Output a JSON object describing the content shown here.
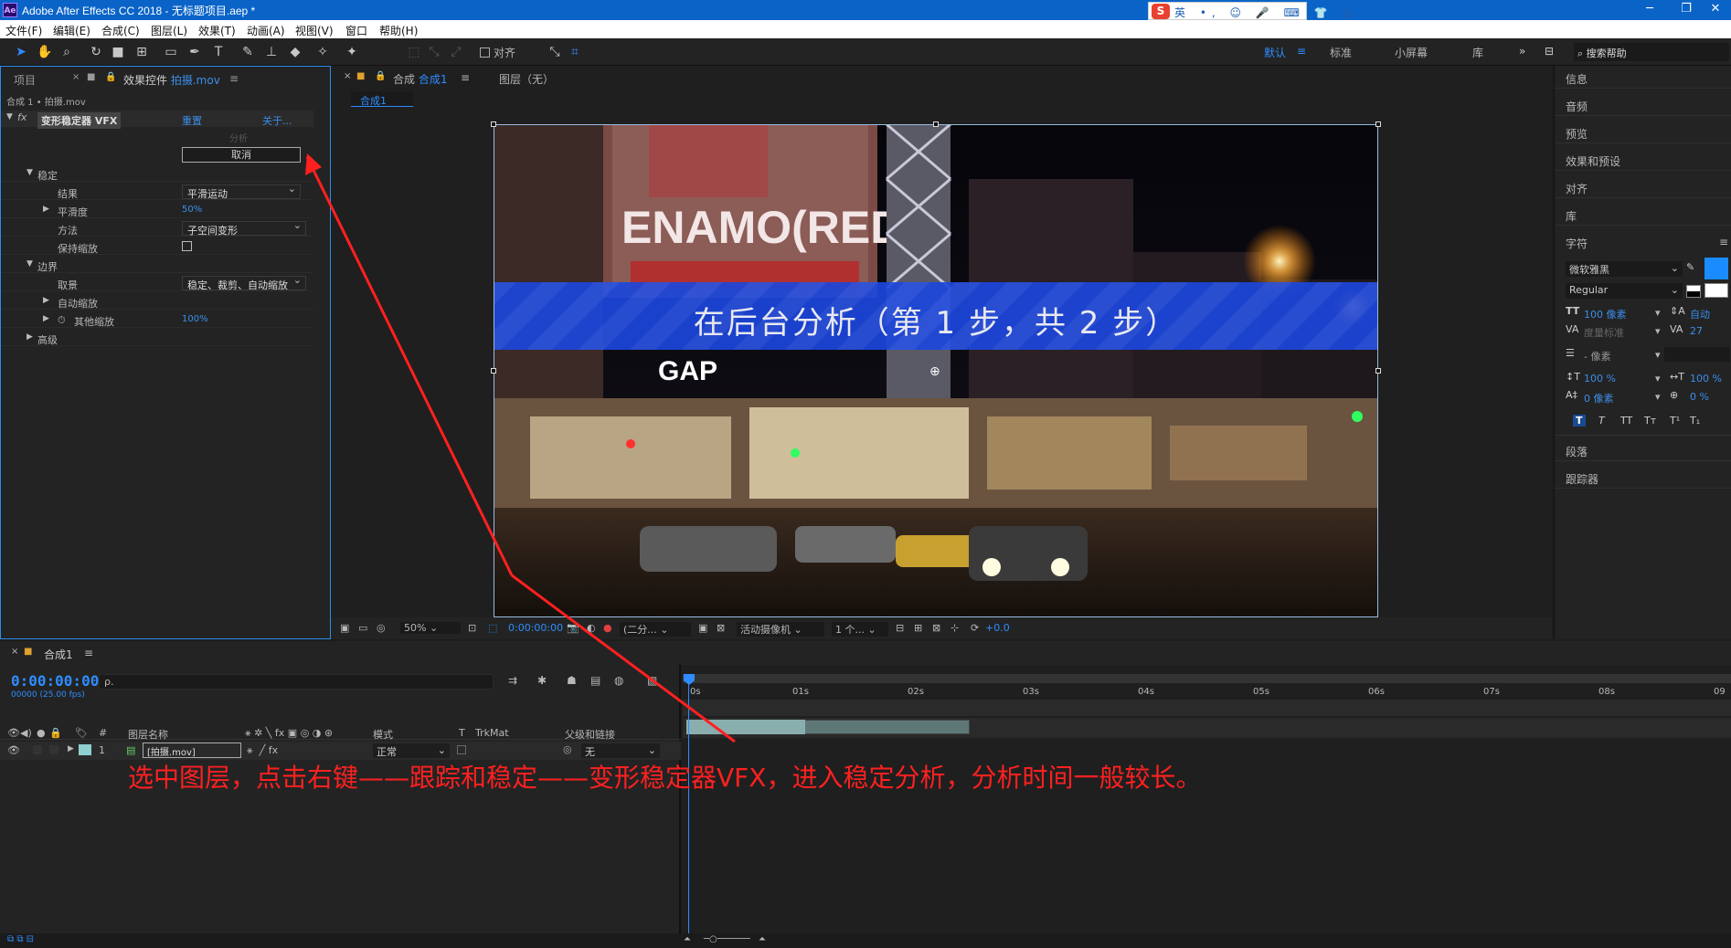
{
  "titlebar": {
    "title": "Adobe After Effects CC 2018 - 无标题项目.aep *",
    "app_icon_text": "Ae",
    "ime_logo": "S",
    "ime_items": "英 •, ☺ 🎤 ⌨ 👕 ▦",
    "minimize": "─",
    "maximize": "❐",
    "close": "✕"
  },
  "menu": [
    "文件(F)",
    "编辑(E)",
    "合成(C)",
    "图层(L)",
    "效果(T)",
    "动画(A)",
    "视图(V)",
    "窗口",
    "帮助(H)"
  ],
  "toolbar": {
    "snap_label": "对齐",
    "workspaces": [
      "默认",
      "标准",
      "小屏幕",
      "库"
    ],
    "more": "»",
    "search_placeholder": "搜索帮助"
  },
  "effect_panel": {
    "tab_project": "项目",
    "tab_effects": "效果控件",
    "tab_effects_file": "拍摄.mov",
    "tab_menu": "≡",
    "breadcrumb": "合成 1 • 拍摄.mov",
    "fx_badge": "fx",
    "effect_name": "变形稳定器 VFX",
    "reset": "重置",
    "about": "关于...",
    "analyze_label": "分析",
    "cancel_button": "取消",
    "rows": {
      "stabilize": "稳定",
      "result": "结果",
      "result_value": "平滑运动",
      "smoothness": "平滑度",
      "smoothness_value": "50%",
      "method": "方法",
      "method_value": "子空间变形",
      "preserve_scale": "保持缩放",
      "borders": "边界",
      "framing": "取景",
      "framing_value": "稳定、裁剪、自动缩放",
      "auto_scale": "自动缩放",
      "additional_scale": "其他缩放",
      "additional_scale_value": "100%",
      "advanced": "高级"
    }
  },
  "comp_panel": {
    "tab_comp_prefix": "合成",
    "tab_comp_name": "合成1",
    "tab_menu": "≡",
    "tab_layer": "图层（无）",
    "sub_tab": "合成1",
    "overlay_text": "在后台分析（第 1 步，共 2 步）",
    "scene_text_billboard": "ENAMO(RED)",
    "scene_text_store": "GAP",
    "viewer_bar": {
      "zoom": "50%",
      "timecode": "0:00:00:00",
      "resolution": "(二分...",
      "camera": "活动摄像机",
      "views": "1 个...",
      "exposure": "+0.0"
    }
  },
  "right_panel": {
    "sections": [
      "信息",
      "音频",
      "预览",
      "效果和预设",
      "对齐",
      "库",
      "字符"
    ],
    "font_family": "微软雅黑",
    "font_style": "Regular",
    "font_size": "100 像素",
    "leading": "自动",
    "kerning": "度量标准",
    "tracking": "27",
    "stroke": "- 像素",
    "vscale": "100 %",
    "hscale": "100 %",
    "baseline": "0 像素",
    "tsume": "0 %",
    "styles": [
      "T",
      "T",
      "TT",
      "Tт",
      "T¹",
      "T₁"
    ],
    "sections_below": [
      "段落",
      "跟踪器"
    ],
    "fill_color": "#1a8cff"
  },
  "timeline": {
    "tab_close": "×",
    "tab_name": "合成1",
    "tab_menu": "≡",
    "timecode": "0:00:00:00",
    "fps": "00000 (25.00 fps)",
    "search_icon": "ρ.",
    "columns": {
      "num": "#",
      "layer_name": "图层名称",
      "mode": "模式",
      "t": "T",
      "trkmat": "TrkMat",
      "parent": "父级和链接"
    },
    "layer": {
      "num": "1",
      "name": "[拍摄.mov]",
      "mode": "正常",
      "parent": "无"
    },
    "ruler": [
      "0s",
      "01s",
      "02s",
      "03s",
      "04s",
      "05s",
      "06s",
      "07s",
      "08s",
      "09"
    ],
    "instruction": "选中图层，点击右键——跟踪和稳定——变形稳定器VFX，进入稳定分析，分析时间一般较长。"
  },
  "colors": {
    "accent": "#2f8cff",
    "annotation": "#ff2020",
    "titlebar": "#0a64c8",
    "overlay_band": "#1c46dc"
  }
}
